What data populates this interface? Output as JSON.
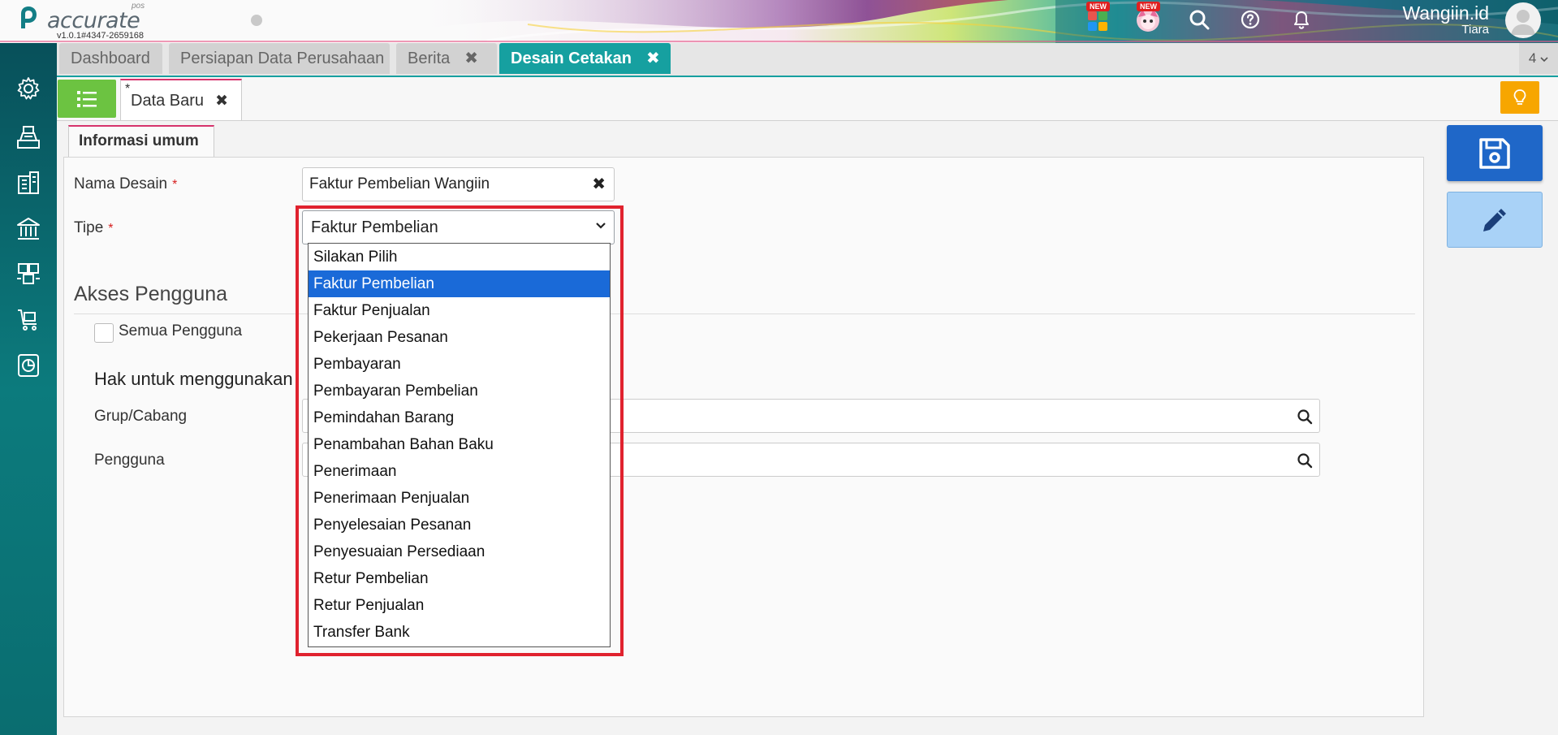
{
  "app": {
    "logo_text": "accurate",
    "logo_sub": "pos",
    "version": "v1.0.1#4347-2659168"
  },
  "header": {
    "new_badge_1": "NEW",
    "new_badge_2": "NEW",
    "user_name": "Wangiin.id",
    "user_sub": "Tiara"
  },
  "tabs": [
    {
      "label": "Dashboard",
      "active": false,
      "closable": false
    },
    {
      "label": "Persiapan Data Perusahaan",
      "active": false,
      "closable": false
    },
    {
      "label": "Berita",
      "active": false,
      "closable": true
    },
    {
      "label": "Desain Cetakan",
      "active": true,
      "closable": true
    }
  ],
  "tab_count": "4",
  "subtab": {
    "star": "*",
    "label": "Data Baru"
  },
  "form": {
    "tab_label": "Informasi umum",
    "nama_desain_label": "Nama Desain",
    "required_mark": "*",
    "nama_desain_value": "Faktur Pembelian Wangiin",
    "tipe_label": "Tipe",
    "tipe_value": "Faktur Pembelian",
    "akses_title": "Akses Pengguna",
    "semua_pengguna_label": "Semua Pengguna",
    "hak_title": "Hak untuk menggunakan",
    "grup_label": "Grup/Cabang",
    "pengguna_label": "Pengguna"
  },
  "dropdown": {
    "selected_index": 1,
    "options": [
      "Silakan Pilih",
      "Faktur Pembelian",
      "Faktur Penjualan",
      "Pekerjaan Pesanan",
      "Pembayaran",
      "Pembayaran Pembelian",
      "Pemindahan Barang",
      "Penambahan Bahan Baku",
      "Penerimaan",
      "Penerimaan Penjualan",
      "Penyelesaian Pesanan",
      "Penyesuaian Persediaan",
      "Retur Pembelian",
      "Retur Penjualan",
      "Transfer Bank"
    ]
  },
  "colors": {
    "teal": "#16a0a0",
    "sidebar": "#0a6d70",
    "save_blue": "#1f67c8",
    "selected_option": "#1a6ad8",
    "highlight_red": "#e0222e",
    "list_green": "#6cc341",
    "bulb_orange": "#f7a600"
  },
  "sidebar_icons": [
    "gear-icon",
    "cashier-icon",
    "building-icon",
    "bank-icon",
    "stock-icon",
    "cart-icon",
    "report-icon"
  ]
}
